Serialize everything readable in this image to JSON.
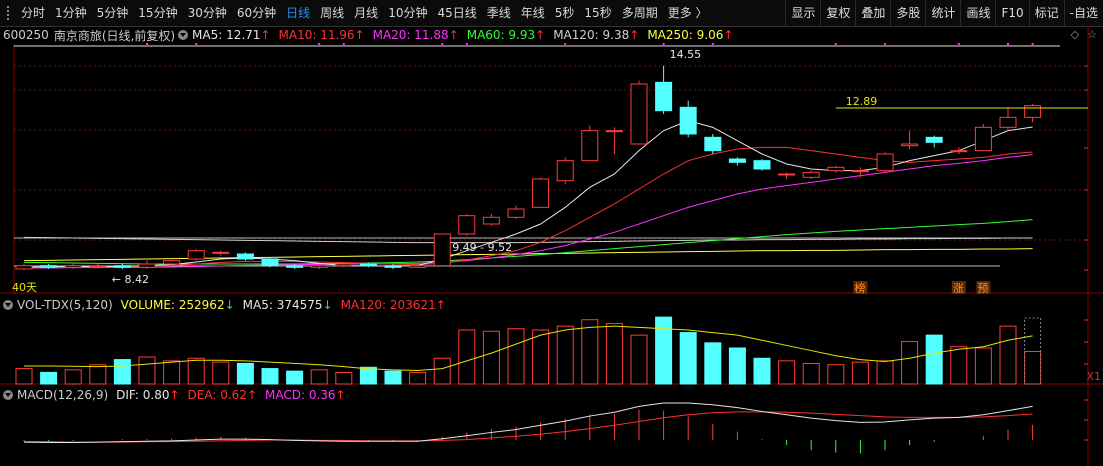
{
  "toolbar": {
    "periods": [
      "分时",
      "1分钟",
      "5分钟",
      "15分钟",
      "30分钟",
      "60分钟",
      "日线",
      "周线",
      "月线",
      "10分钟",
      "45日线",
      "季线",
      "年线",
      "5秒",
      "15秒",
      "多周期",
      "更多 〉"
    ],
    "active": "日线",
    "right": [
      "显示",
      "复权",
      "叠加",
      "多股",
      "统计",
      "画线",
      "F10",
      "标记",
      "-自选"
    ]
  },
  "main_legend": {
    "code": "600250",
    "name": "南京商旅",
    "mode": "(日线,前复权)",
    "items": [
      {
        "label": "MA5: 12.71",
        "color": "#e6e6e6",
        "arrow": "↑"
      },
      {
        "label": "MA10: 11.96",
        "color": "#ff3030",
        "arrow": "↑"
      },
      {
        "label": "MA20: 11.88",
        "color": "#ff30ff",
        "arrow": "↑"
      },
      {
        "label": "MA60: 9.93",
        "color": "#30ff30",
        "arrow": "↑"
      },
      {
        "label": "MA120: 9.38",
        "color": "#d0d0d0",
        "arrow": "↑"
      },
      {
        "label": "MA250: 9.06",
        "color": "#ffff40",
        "arrow": "↑"
      }
    ]
  },
  "price_annotations": {
    "high": "14.55",
    "low": "8.42",
    "mid_range": "9.49 - 9.52",
    "hline": "12.89",
    "days": "40天"
  },
  "markers": [
    "榜",
    "涨",
    "预"
  ],
  "vol_legend": {
    "name": "VOL-TDX(5,120)",
    "items": [
      {
        "label": "VOLUME: 252962",
        "color": "#ffff40",
        "arrow": "↓"
      },
      {
        "label": "MA5: 374575",
        "color": "#e6e6e6",
        "arrow": "↓"
      },
      {
        "label": "MA120: 203621",
        "color": "#ff3030",
        "arrow": "↑"
      }
    ]
  },
  "macd_legend": {
    "name": "MACD(12,26,9)",
    "items": [
      {
        "label": "DIF: 0.80",
        "color": "#e6e6e6",
        "arrow": "↑"
      },
      {
        "label": "DEA: 0.62",
        "color": "#ff3030",
        "arrow": "↑"
      },
      {
        "label": "MACD: 0.36",
        "color": "#ff30ff",
        "arrow": "↑"
      }
    ]
  },
  "vol_axis_label": "X1",
  "chart_data": {
    "type": "candlestick",
    "candles": [
      {
        "o": 8.45,
        "c": 8.55,
        "h": 8.6,
        "l": 8.42
      },
      {
        "o": 8.55,
        "c": 8.5,
        "h": 8.6,
        "l": 8.45
      },
      {
        "o": 8.5,
        "c": 8.55,
        "h": 8.65,
        "l": 8.45
      },
      {
        "o": 8.55,
        "c": 8.55,
        "h": 8.6,
        "l": 8.5
      },
      {
        "o": 8.55,
        "c": 8.5,
        "h": 8.6,
        "l": 8.45
      },
      {
        "o": 8.5,
        "c": 8.6,
        "h": 8.7,
        "l": 8.45
      },
      {
        "o": 8.6,
        "c": 8.7,
        "h": 8.8,
        "l": 8.55
      },
      {
        "o": 8.75,
        "c": 9.0,
        "h": 9.05,
        "l": 8.7
      },
      {
        "o": 8.95,
        "c": 8.95,
        "h": 9.0,
        "l": 8.85
      },
      {
        "o": 8.9,
        "c": 8.75,
        "h": 8.95,
        "l": 8.7
      },
      {
        "o": 8.75,
        "c": 8.55,
        "h": 8.8,
        "l": 8.5
      },
      {
        "o": 8.55,
        "c": 8.5,
        "h": 8.6,
        "l": 8.45
      },
      {
        "o": 8.5,
        "c": 8.55,
        "h": 8.6,
        "l": 8.45
      },
      {
        "o": 8.55,
        "c": 8.6,
        "h": 8.65,
        "l": 8.5
      },
      {
        "o": 8.6,
        "c": 8.55,
        "h": 8.65,
        "l": 8.5
      },
      {
        "o": 8.55,
        "c": 8.5,
        "h": 8.6,
        "l": 8.45
      },
      {
        "o": 8.5,
        "c": 8.55,
        "h": 8.6,
        "l": 8.48
      },
      {
        "o": 8.55,
        "c": 9.5,
        "h": 9.52,
        "l": 8.55
      },
      {
        "o": 9.5,
        "c": 10.05,
        "h": 10.1,
        "l": 9.45
      },
      {
        "o": 9.8,
        "c": 10.0,
        "h": 10.1,
        "l": 9.75
      },
      {
        "o": 10.0,
        "c": 10.25,
        "h": 10.35,
        "l": 9.95
      },
      {
        "o": 10.3,
        "c": 11.15,
        "h": 11.2,
        "l": 10.3
      },
      {
        "o": 11.1,
        "c": 11.7,
        "h": 11.8,
        "l": 11.0
      },
      {
        "o": 11.7,
        "c": 12.6,
        "h": 12.75,
        "l": 11.7
      },
      {
        "o": 12.6,
        "c": 12.6,
        "h": 12.7,
        "l": 11.9
      },
      {
        "o": 12.2,
        "c": 14.0,
        "h": 14.1,
        "l": 12.2
      },
      {
        "o": 14.05,
        "c": 13.2,
        "h": 14.55,
        "l": 13.1
      },
      {
        "o": 13.3,
        "c": 12.5,
        "h": 13.5,
        "l": 12.4
      },
      {
        "o": 12.4,
        "c": 12.0,
        "h": 12.5,
        "l": 11.9
      },
      {
        "o": 11.75,
        "c": 11.65,
        "h": 11.8,
        "l": 11.55
      },
      {
        "o": 11.7,
        "c": 11.45,
        "h": 11.75,
        "l": 11.4
      },
      {
        "o": 11.3,
        "c": 11.3,
        "h": 11.35,
        "l": 11.15
      },
      {
        "o": 11.2,
        "c": 11.35,
        "h": 11.4,
        "l": 11.15
      },
      {
        "o": 11.4,
        "c": 11.5,
        "h": 11.55,
        "l": 11.35
      },
      {
        "o": 11.4,
        "c": 11.4,
        "h": 11.5,
        "l": 11.2
      },
      {
        "o": 11.4,
        "c": 11.9,
        "h": 11.95,
        "l": 11.35
      },
      {
        "o": 12.15,
        "c": 12.2,
        "h": 12.6,
        "l": 12.05
      },
      {
        "o": 12.4,
        "c": 12.25,
        "h": 12.45,
        "l": 12.1
      },
      {
        "o": 12.0,
        "c": 12.0,
        "h": 12.1,
        "l": 11.9
      },
      {
        "o": 12.0,
        "c": 12.7,
        "h": 12.8,
        "l": 12.0
      },
      {
        "o": 12.7,
        "c": 13.0,
        "h": 13.3,
        "l": 12.6
      },
      {
        "o": 13.0,
        "c": 13.35,
        "h": 13.4,
        "l": 12.85
      }
    ],
    "ma5": [
      8.5,
      8.52,
      8.52,
      8.53,
      8.53,
      8.55,
      8.58,
      8.66,
      8.75,
      8.78,
      8.75,
      8.7,
      8.62,
      8.55,
      8.54,
      8.54,
      8.55,
      8.75,
      9.0,
      9.25,
      9.5,
      9.8,
      10.3,
      10.9,
      11.3,
      12.0,
      12.6,
      12.9,
      12.7,
      12.3,
      11.9,
      11.6,
      11.45,
      11.4,
      11.4,
      11.5,
      11.7,
      11.85,
      12.0,
      12.3,
      12.6,
      12.71
    ],
    "ma10": [
      8.5,
      8.5,
      8.51,
      8.52,
      8.52,
      8.53,
      8.55,
      8.6,
      8.65,
      8.68,
      8.68,
      8.68,
      8.66,
      8.64,
      8.62,
      8.6,
      8.58,
      8.62,
      8.72,
      8.85,
      9.0,
      9.25,
      9.6,
      10.0,
      10.4,
      10.85,
      11.3,
      11.7,
      11.9,
      12.05,
      12.1,
      12.1,
      12.0,
      11.9,
      11.8,
      11.7,
      11.65,
      11.7,
      11.75,
      11.8,
      11.9,
      11.96
    ],
    "ma20": [
      8.48,
      8.48,
      8.49,
      8.49,
      8.5,
      8.5,
      8.51,
      8.52,
      8.54,
      8.56,
      8.57,
      8.58,
      8.59,
      8.6,
      8.6,
      8.61,
      8.62,
      8.65,
      8.7,
      8.78,
      8.88,
      9.0,
      9.15,
      9.35,
      9.55,
      9.8,
      10.05,
      10.3,
      10.5,
      10.7,
      10.85,
      10.95,
      11.05,
      11.15,
      11.25,
      11.35,
      11.45,
      11.55,
      11.62,
      11.7,
      11.8,
      11.88
    ],
    "ma60": [
      8.65,
      8.64,
      8.63,
      8.62,
      8.61,
      8.6,
      8.6,
      8.6,
      8.6,
      8.6,
      8.6,
      8.6,
      8.61,
      8.62,
      8.63,
      8.64,
      8.66,
      8.69,
      8.73,
      8.78,
      8.83,
      8.88,
      8.94,
      9.0,
      9.06,
      9.12,
      9.18,
      9.24,
      9.3,
      9.36,
      9.42,
      9.48,
      9.53,
      9.58,
      9.62,
      9.66,
      9.7,
      9.74,
      9.78,
      9.82,
      9.87,
      9.93
    ],
    "ma120": [
      9.4,
      9.39,
      9.38,
      9.37,
      9.36,
      9.35,
      9.34,
      9.33,
      9.32,
      9.31,
      9.3,
      9.29,
      9.28,
      9.27,
      9.26,
      9.25,
      9.24,
      9.24,
      9.24,
      9.24,
      9.24,
      9.25,
      9.26,
      9.27,
      9.28,
      9.29,
      9.3,
      9.31,
      9.32,
      9.32,
      9.33,
      9.33,
      9.34,
      9.34,
      9.35,
      9.35,
      9.36,
      9.36,
      9.37,
      9.37,
      9.38,
      9.38
    ],
    "ma250": [
      8.7,
      8.71,
      8.72,
      8.73,
      8.74,
      8.75,
      8.76,
      8.77,
      8.78,
      8.79,
      8.8,
      8.81,
      8.82,
      8.83,
      8.84,
      8.85,
      8.86,
      8.87,
      8.88,
      8.89,
      8.9,
      8.91,
      8.92,
      8.93,
      8.94,
      8.95,
      8.96,
      8.97,
      8.98,
      8.99,
      9.0,
      9.0,
      9.01,
      9.01,
      9.02,
      9.03,
      9.03,
      9.04,
      9.04,
      9.05,
      9.05,
      9.06
    ],
    "volume": [
      120000,
      90000,
      110000,
      150000,
      190000,
      210000,
      180000,
      200000,
      170000,
      160000,
      120000,
      100000,
      110000,
      90000,
      130000,
      100000,
      90000,
      200000,
      420000,
      410000,
      430000,
      420000,
      450000,
      500000,
      470000,
      380000,
      520000,
      400000,
      320000,
      280000,
      200000,
      180000,
      160000,
      150000,
      170000,
      180000,
      330000,
      380000,
      290000,
      280000,
      450000,
      252962
    ],
    "vol_ma5": [
      140000,
      140000,
      138000,
      135000,
      140000,
      155000,
      170000,
      185000,
      185000,
      180000,
      170000,
      160000,
      150000,
      135000,
      118000,
      110000,
      105000,
      120000,
      180000,
      240000,
      310000,
      380000,
      420000,
      440000,
      450000,
      440000,
      430000,
      420000,
      400000,
      380000,
      340000,
      300000,
      260000,
      220000,
      190000,
      175000,
      200000,
      240000,
      270000,
      290000,
      340000,
      374575
    ],
    "dif": [
      -0.05,
      -0.06,
      -0.06,
      -0.05,
      -0.04,
      -0.03,
      -0.02,
      0.0,
      0.02,
      0.02,
      0.01,
      -0.01,
      -0.02,
      -0.03,
      -0.03,
      -0.03,
      -0.03,
      0.03,
      0.1,
      0.18,
      0.25,
      0.35,
      0.45,
      0.57,
      0.66,
      0.8,
      0.88,
      0.88,
      0.84,
      0.77,
      0.68,
      0.6,
      0.52,
      0.46,
      0.42,
      0.43,
      0.48,
      0.52,
      0.54,
      0.6,
      0.7,
      0.8
    ],
    "dea": [
      -0.04,
      -0.04,
      -0.05,
      -0.05,
      -0.05,
      -0.04,
      -0.04,
      -0.03,
      -0.02,
      -0.01,
      0.0,
      0.0,
      -0.01,
      -0.01,
      -0.02,
      -0.02,
      -0.02,
      -0.01,
      0.01,
      0.05,
      0.09,
      0.14,
      0.2,
      0.27,
      0.35,
      0.44,
      0.53,
      0.6,
      0.65,
      0.67,
      0.67,
      0.66,
      0.64,
      0.61,
      0.58,
      0.55,
      0.54,
      0.54,
      0.54,
      0.55,
      0.58,
      0.62
    ],
    "y_range": [
      8.0,
      15.2
    ]
  }
}
